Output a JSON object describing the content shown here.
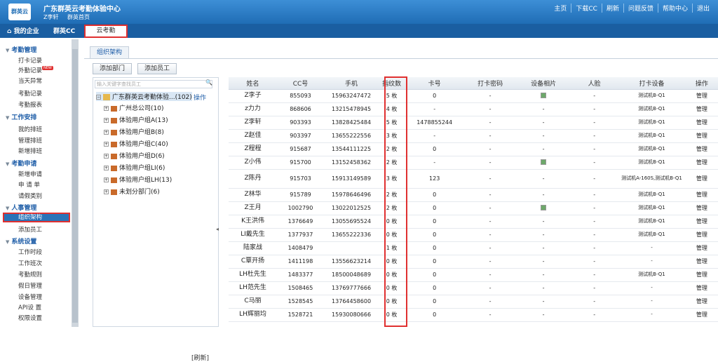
{
  "header": {
    "logo_text": "群英云",
    "title": "广东群英云考勤体验中心",
    "user": "Z李轩",
    "home_link": "群英首页",
    "links": [
      "主页",
      "下载CC",
      "刷新",
      "问题反馈",
      "帮助中心",
      "退出"
    ]
  },
  "tabs": [
    {
      "label": "⌂ 我的企业",
      "active": false
    },
    {
      "label": "群英CC",
      "active": false
    },
    {
      "label": "云考勤",
      "active": true
    }
  ],
  "sidebar": {
    "groups": [
      {
        "label": "考勤管理",
        "items": [
          "打卡记录",
          "外勤记录",
          "当天异常",
          "考勤记录",
          "考勤报表"
        ]
      },
      {
        "label": "工作安排",
        "items": [
          "我的排班",
          "管理排班",
          "新增排班"
        ]
      },
      {
        "label": "考勤申请",
        "items": [
          "新增申请",
          "申 请 单",
          "请假类别"
        ]
      },
      {
        "label": "人事管理",
        "items": [
          "组织架构",
          "添加员工"
        ]
      },
      {
        "label": "系统设置",
        "items": [
          "工作时段",
          "工作班次",
          "考勤规则",
          "假日管理",
          "设备管理",
          "API设 置",
          "权限设置"
        ]
      }
    ],
    "new_badge": "NEW",
    "active_item": "组织架构"
  },
  "content": {
    "tab": "组织架构",
    "buttons": [
      "添加部门",
      "添加员工"
    ],
    "search_placeholder": "输入关键字查找员工",
    "tree": {
      "root": "广东群英云考勤体验...(102)",
      "operation": "操作",
      "children": [
        "广州总公司(10)",
        "体验用户组A(13)",
        "体验用户组B(8)",
        "体验用户组C(40)",
        "体验用户组D(6)",
        "体验用户组LI(6)",
        "体验用户组LH(13)",
        "未划分部门(6)"
      ]
    },
    "refresh": "[刷新]"
  },
  "table": {
    "columns": [
      "姓名",
      "CC号",
      "手机",
      "指纹数",
      "卡号",
      "打卡密码",
      "设备相片",
      "人脸",
      "打卡设备",
      "操作"
    ],
    "rows": [
      [
        "Z李子",
        "855093",
        "15963247472",
        "5 枚",
        "0",
        "-",
        "photo",
        "-",
        "测试机B-Q1",
        "管理"
      ],
      [
        "z力力",
        "868606",
        "13215478945",
        "4 枚",
        "-",
        "-",
        "-",
        "-",
        "测试机B-Q1",
        "管理"
      ],
      [
        "Z李轩",
        "903393",
        "13828425484",
        "5 枚",
        "1478855244",
        "-",
        "-",
        "-",
        "测试机B-Q1",
        "管理"
      ],
      [
        "Z赵佳",
        "903397",
        "13655222556",
        "3 枚",
        "-",
        "-",
        "-",
        "-",
        "测试机B-Q1",
        "管理"
      ],
      [
        "Z程程",
        "915687",
        "13544111225",
        "2 枚",
        "0",
        "-",
        "-",
        "-",
        "测试机B-Q1",
        "管理"
      ],
      [
        "Z小伟",
        "915700",
        "13152458362",
        "2 枚",
        "-",
        "-",
        "photo",
        "-",
        "测试机B-Q1",
        "管理"
      ],
      [
        "Z陈丹",
        "915703",
        "15913149589",
        "3 枚",
        "123",
        "-",
        "-",
        "-",
        "测试机A-160S,测试机B-Q1",
        "管理"
      ],
      [
        "Z林华",
        "915789",
        "15978646496",
        "2 枚",
        "0",
        "-",
        "-",
        "-",
        "测试机B-Q1",
        "管理"
      ],
      [
        "Z王月",
        "1002790",
        "13022012525",
        "2 枚",
        "0",
        "-",
        "photo",
        "-",
        "测试机B-Q1",
        "管理"
      ],
      [
        "K王洪伟",
        "1376649",
        "13055695524",
        "0 枚",
        "0",
        "-",
        "-",
        "-",
        "测试机B-Q1",
        "管理"
      ],
      [
        "LI戴先生",
        "1377937",
        "13655222336",
        "0 枚",
        "0",
        "-",
        "-",
        "-",
        "测试机B-Q1",
        "管理"
      ],
      [
        "陆家战",
        "1408479",
        "",
        "1 枚",
        "0",
        "-",
        "-",
        "-",
        "-",
        "管理"
      ],
      [
        "C覃开扬",
        "1411198",
        "13556623214",
        "0 枚",
        "0",
        "-",
        "-",
        "-",
        "-",
        "管理"
      ],
      [
        "LH杜先生",
        "1483377",
        "18500048689",
        "0 枚",
        "0",
        "-",
        "-",
        "-",
        "测试机B-Q1",
        "管理"
      ],
      [
        "LH范先生",
        "1508465",
        "13769777666",
        "0 枚",
        "0",
        "-",
        "-",
        "-",
        "-",
        "管理"
      ],
      [
        "C马丽",
        "1528545",
        "13764458600",
        "0 枚",
        "0",
        "-",
        "-",
        "-",
        "-",
        "管理"
      ],
      [
        "LH辉丽均",
        "1528721",
        "15930080666",
        "0 枚",
        "0",
        "-",
        "-",
        "-",
        "-",
        "管理"
      ]
    ]
  }
}
